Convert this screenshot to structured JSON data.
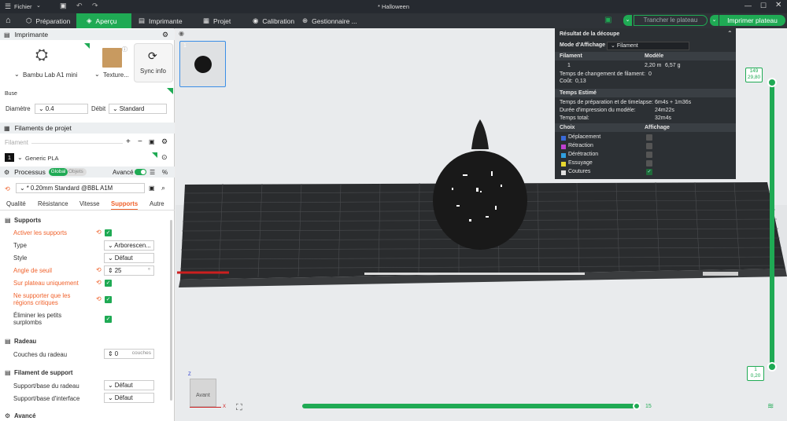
{
  "window": {
    "title": "* Halloween",
    "file_menu": "Fichier"
  },
  "tabs": [
    {
      "label": "Préparation"
    },
    {
      "label": "Aperçu"
    },
    {
      "label": "Imprimante"
    },
    {
      "label": "Projet"
    },
    {
      "label": "Calibration"
    },
    {
      "label": "Gestionnaire ..."
    }
  ],
  "actions": {
    "slice": "Trancher le plateau",
    "print": "Imprimer plateau"
  },
  "printer": {
    "section": "Imprimante",
    "name": "Bambu Lab A1 mini",
    "plate": "Texture...",
    "sync": "Sync info",
    "nozzle_section": "Buse",
    "diameter_label": "Diamètre",
    "diameter_value": "0.4",
    "flow_label": "Débit",
    "flow_value": "Standard"
  },
  "filaments": {
    "section": "Filaments de projet",
    "header": "Filament",
    "items": [
      {
        "index": "1",
        "name": "Generic PLA"
      }
    ]
  },
  "process": {
    "section": "Processus",
    "toggle_global": "Global",
    "toggle_objects": "Objets",
    "advanced": "Avancé",
    "profile": "* 0.20mm Standard @BBL A1M",
    "tabs": [
      "Qualité",
      "Résistance",
      "Vitesse",
      "Supports",
      "Autre"
    ],
    "active_tab": "Supports"
  },
  "supports": {
    "group_supports": "Supports",
    "enable": "Activer les supports",
    "type_label": "Type",
    "type_value": "Arborescen...",
    "style_label": "Style",
    "style_value": "Défaut",
    "threshold_label": "Angle de seuil",
    "threshold_value": "25",
    "threshold_unit": "°",
    "build_plate_only": "Sur plateau uniquement",
    "critical_regions_1": "Ne supporter que les",
    "critical_regions_2": "régions critiques",
    "remove_small_1": "Éliminer les petits",
    "remove_small_2": "surplombs",
    "group_raft": "Radeau",
    "raft_layers_label": "Couches du radeau",
    "raft_layers_value": "0",
    "raft_layers_unit": "couches",
    "group_filament": "Filament de support",
    "raft_base_label": "Support/base du radeau",
    "raft_base_value": "Défaut",
    "interface_label": "Support/base d'interface",
    "interface_value": "Défaut",
    "group_advanced": "Avancé"
  },
  "thumbnail": {
    "index": "1"
  },
  "slice_result": {
    "title": "Résultat de la découpe",
    "mode_label": "Mode d'Affichage",
    "mode_value": "Filament",
    "col_filament": "Filament",
    "col_model": "Modèle",
    "filament_index": "1",
    "length": "2,20 m",
    "weight": "6,57 g",
    "filament_change_label": "Temps de changement de filament:",
    "filament_change_value": "0",
    "cost_label": "Coût:",
    "cost_value": "0,13",
    "time_section": "Temps Estimé",
    "prep_label": "Temps de préparation et de timelapse:",
    "prep_value": "6m4s + 1m36s",
    "model_label": "Durée d'impression du modèle:",
    "model_value": "24m22s",
    "total_label": "Temps total:",
    "total_value": "32m4s",
    "col_choice": "Choix",
    "col_display": "Affichage",
    "legend": [
      {
        "label": "Déplacement",
        "color": "#3a6ad8"
      },
      {
        "label": "Rétraction",
        "color": "#c040d0"
      },
      {
        "label": "Dérétraction",
        "color": "#30a0e0"
      },
      {
        "label": "Essuyage",
        "color": "#e8d830"
      },
      {
        "label": "Coutures",
        "color": "#e0e0e0"
      }
    ]
  },
  "layer_slider": {
    "top_layer": "149",
    "top_height": "29,80",
    "bottom_layer": "1",
    "bottom_height": "0,20"
  },
  "move_slider": {
    "value": "15"
  },
  "view_cube": {
    "face": "Avant",
    "axis_x": "X",
    "axis_z": "Z"
  },
  "colors": {
    "accent": "#1faa54",
    "warning": "#f0622c",
    "dark": "#2c3034"
  }
}
